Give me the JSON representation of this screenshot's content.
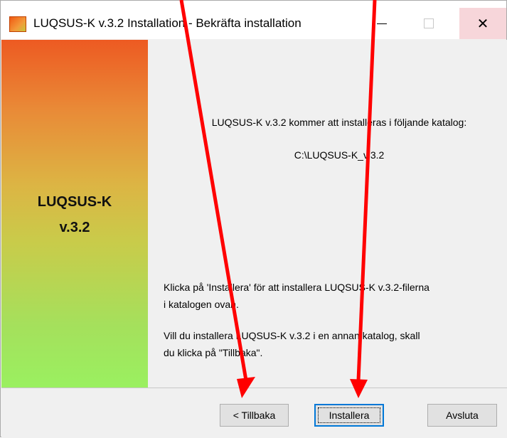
{
  "window": {
    "title": "LUQSUS-K v.3.2 Installation - Bekräfta installation",
    "controls": [
      "minimize",
      "maximize",
      "close"
    ]
  },
  "banner": {
    "line1": "LUQSUS-K",
    "line2": "v.3.2"
  },
  "content": {
    "install_target_text": "LUQSUS-K v.3.2 kommer att installeras i följande katalog:",
    "install_path": "C:\\LUQSUS-K_v.3.2",
    "instruction_line1": "Klicka på 'Installera' för att installera LUQSUS-K v.3.2-filerna",
    "instruction_line2": "i katalogen ovan.",
    "alt_line1": "Vill du installera LUQSUS-K v.3.2 i en annan katalog, skall",
    "alt_line2": "du klicka på \"Tillbaka\"."
  },
  "footer": {
    "back_label": "< Tillbaka",
    "install_label": "Installera",
    "exit_label": "Avsluta"
  },
  "annotations": {
    "arrow_color": "#ff0000"
  }
}
